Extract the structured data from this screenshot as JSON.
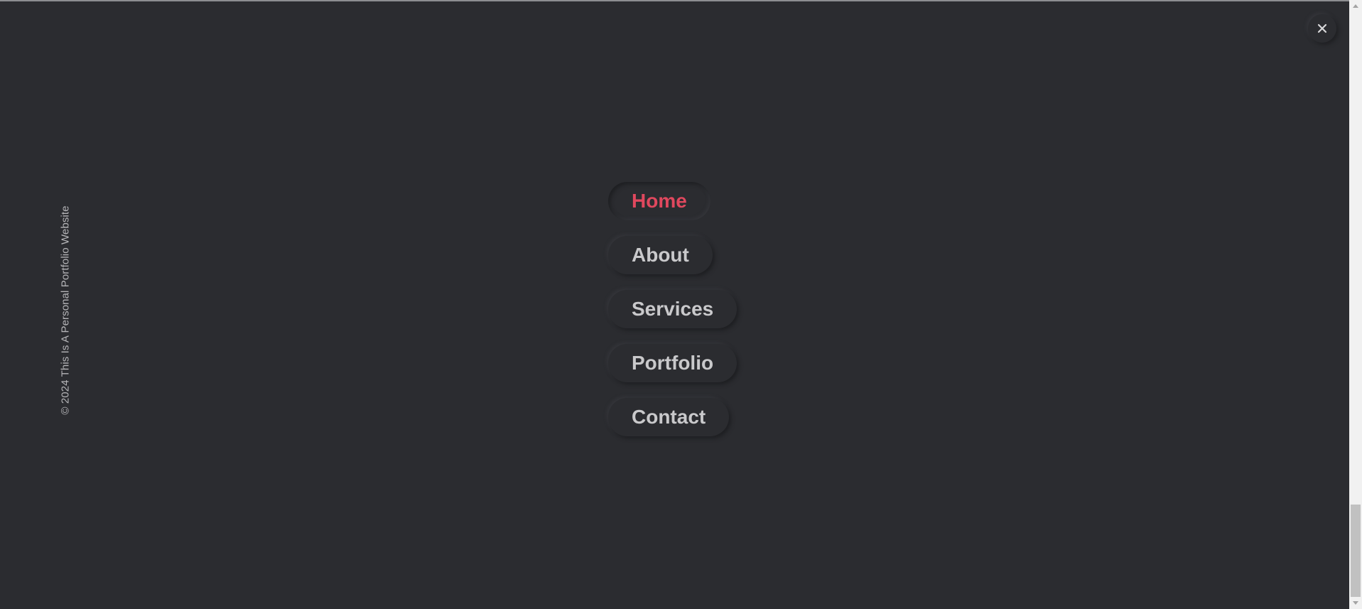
{
  "footer": {
    "copyright": "© 2024 This Is A Personal Portfolio Website"
  },
  "menu": {
    "items": [
      {
        "label": "Home",
        "active": true
      },
      {
        "label": "About",
        "active": false
      },
      {
        "label": "Services",
        "active": false
      },
      {
        "label": "Portfolio",
        "active": false
      },
      {
        "label": "Contact",
        "active": false
      }
    ]
  },
  "close": {
    "icon": "close-icon"
  },
  "colors": {
    "background": "#2b2c30",
    "accent": "#e0485e",
    "menu_text": "#c9c9cb"
  },
  "scrollbar": {
    "position_fraction": 0.83
  }
}
